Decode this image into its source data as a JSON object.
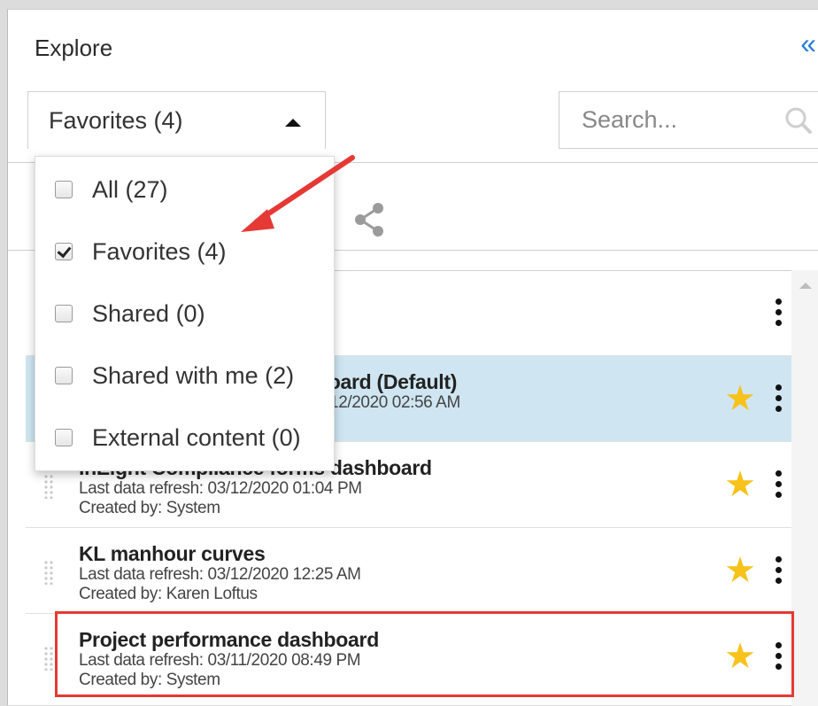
{
  "header": {
    "title": "Explore",
    "collapse_icon": "double-chevron-left-icon"
  },
  "filter": {
    "selected_label": "Favorites (4)",
    "options": [
      {
        "label": "All (27)",
        "checked": false
      },
      {
        "label": "Favorites (4)",
        "checked": true
      },
      {
        "label": "Shared (0)",
        "checked": false
      },
      {
        "label": "Shared with me (2)",
        "checked": false
      },
      {
        "label": "External content (0)",
        "checked": false
      }
    ]
  },
  "search": {
    "placeholder": "Search...",
    "value": ""
  },
  "toolbar": {
    "share_icon": "share-icon"
  },
  "list": {
    "items": [
      {
        "title": "",
        "refresh": "",
        "created": "",
        "favorite": false
      },
      {
        "title": "board (Default)",
        "refresh": "3/12/2020 02:56 AM",
        "created": "",
        "favorite": true
      },
      {
        "title": "InEight Compliance forms dashboard",
        "refresh": "Last data refresh: 03/12/2020 01:04 PM",
        "created": "Created by: System",
        "favorite": true
      },
      {
        "title": "KL manhour curves",
        "refresh": "Last data refresh: 03/12/2020 12:25 AM",
        "created": "Created by: Karen Loftus",
        "favorite": true
      },
      {
        "title": "Project performance dashboard",
        "refresh": "Last data refresh: 03/11/2020 08:49 PM",
        "created": "Created by: System",
        "favorite": true
      }
    ]
  },
  "colors": {
    "accent": "#2a7bd6",
    "star": "#f7c21a",
    "highlight": "#cfe6f2",
    "annotation": "#e53935"
  }
}
